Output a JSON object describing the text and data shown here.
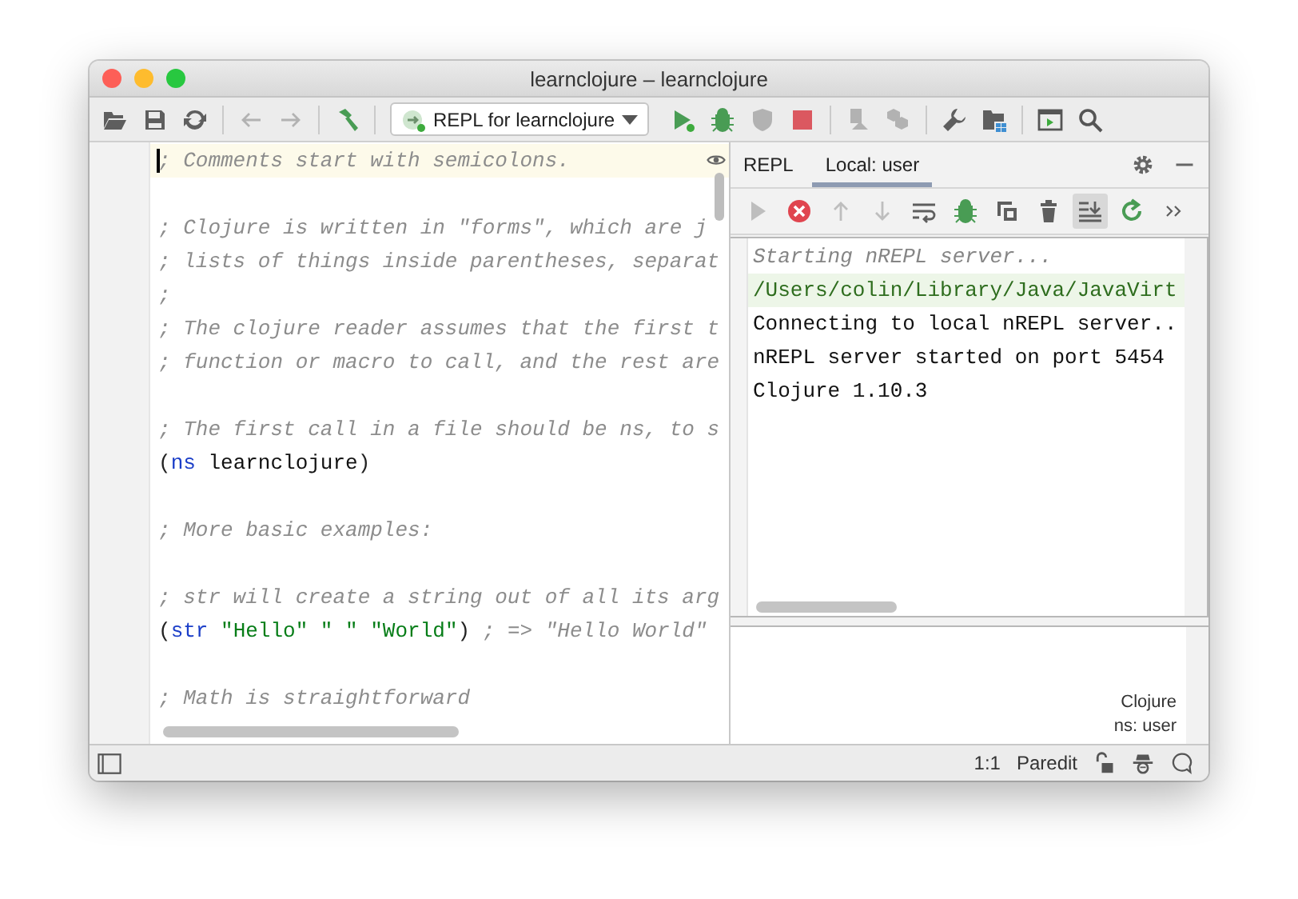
{
  "window": {
    "title": "learnclojure – learnclojure"
  },
  "toolbar": {
    "groups": [
      [
        {
          "kind": "open",
          "disabled": false
        },
        {
          "kind": "save",
          "disabled": false
        },
        {
          "kind": "sync",
          "disabled": false
        }
      ],
      [
        {
          "kind": "back",
          "disabled": true
        },
        {
          "kind": "forward",
          "disabled": true
        }
      ],
      [
        {
          "kind": "build",
          "disabled": false
        }
      ],
      [
        {
          "kind": "config",
          "disabled": false
        },
        {
          "kind": "run",
          "disabled": false
        },
        {
          "kind": "debug",
          "disabled": false
        },
        {
          "kind": "coverage",
          "disabled": true
        },
        {
          "kind": "stop",
          "disabled": false
        }
      ],
      [
        {
          "kind": "attach",
          "disabled": true
        },
        {
          "kind": "deploy",
          "disabled": true
        }
      ],
      [
        {
          "kind": "wrench",
          "disabled": false
        },
        {
          "kind": "structure",
          "disabled": false
        }
      ],
      [
        {
          "kind": "terminal",
          "disabled": false
        },
        {
          "kind": "search",
          "disabled": false
        }
      ]
    ],
    "run_config": "REPL for learnclojure"
  },
  "editor": {
    "lines": [
      {
        "current": true,
        "tokens": [
          {
            "kind": "comment",
            "text": "; Comments start with semicolons."
          }
        ]
      },
      {
        "current": false
      },
      {
        "current": false,
        "tokens": [
          {
            "kind": "comment",
            "text": "; Clojure is written in \"forms\", which are j"
          }
        ]
      },
      {
        "current": false,
        "tokens": [
          {
            "kind": "comment",
            "text": "; lists of things inside parentheses, separat"
          }
        ]
      },
      {
        "current": false,
        "tokens": [
          {
            "kind": "comment",
            "text": ";"
          }
        ]
      },
      {
        "current": false,
        "tokens": [
          {
            "kind": "comment",
            "text": "; The clojure reader assumes that the first t"
          }
        ]
      },
      {
        "current": false,
        "tokens": [
          {
            "kind": "comment",
            "text": "; function or macro to call, and the rest are"
          }
        ]
      },
      {
        "current": false
      },
      {
        "current": false,
        "tokens": [
          {
            "kind": "comment",
            "text": "; The first call in a file should be ns, to s"
          }
        ]
      },
      {
        "current": false,
        "tokens": [
          {
            "kind": "paren",
            "text": "("
          },
          {
            "kind": "keyword",
            "text": "ns"
          },
          {
            "kind": "plain",
            "text": " learnclojure"
          },
          {
            "kind": "paren",
            "text": ")"
          }
        ]
      },
      {
        "current": false
      },
      {
        "current": false,
        "tokens": [
          {
            "kind": "comment",
            "text": "; More basic examples:"
          }
        ]
      },
      {
        "current": false
      },
      {
        "current": false,
        "tokens": [
          {
            "kind": "comment",
            "text": "; str will create a string out of all its arg"
          }
        ]
      },
      {
        "current": false,
        "tokens": [
          {
            "kind": "paren",
            "text": "("
          },
          {
            "kind": "keyword",
            "text": "str"
          },
          {
            "kind": "string",
            "text": " \"Hello\" \" \" \"World\""
          },
          {
            "kind": "paren",
            "text": ")"
          },
          {
            "kind": "comment",
            "text": " ; => \"Hello World\""
          }
        ]
      },
      {
        "current": false
      },
      {
        "current": false,
        "tokens": [
          {
            "kind": "comment",
            "text": "; Math is straightforward"
          }
        ]
      }
    ]
  },
  "repl": {
    "tabs": [
      {
        "label": "REPL",
        "selected": false
      },
      {
        "label": "Local: user",
        "selected": true
      }
    ],
    "tools": [
      {
        "kind": "play",
        "disabled": true,
        "on": false
      },
      {
        "kind": "stop",
        "disabled": false,
        "on": false
      },
      {
        "kind": "up",
        "disabled": true,
        "on": false
      },
      {
        "kind": "down",
        "disabled": true,
        "on": false
      },
      {
        "kind": "wrap",
        "disabled": false,
        "on": false
      },
      {
        "kind": "debug",
        "disabled": false,
        "on": false
      },
      {
        "kind": "copy",
        "disabled": false,
        "on": false
      },
      {
        "kind": "trash",
        "disabled": false,
        "on": false
      },
      {
        "kind": "scroll",
        "disabled": false,
        "on": true
      },
      {
        "kind": "rerun",
        "disabled": false,
        "on": false
      },
      {
        "kind": "more",
        "disabled": false,
        "on": false
      }
    ],
    "output": [
      {
        "kind": "system",
        "text": "Starting nREPL server..."
      },
      {
        "kind": "path",
        "text": "/Users/colin/Library/Java/JavaVirt"
      },
      {
        "kind": "plain",
        "text": "Connecting to local nREPL server.."
      },
      {
        "kind": "plain",
        "text": "nREPL server started on port 5454"
      },
      {
        "kind": "plain",
        "text": "Clojure 1.10.3"
      }
    ],
    "language": "Clojure",
    "namespace": "ns: user"
  },
  "status_bar": {
    "position": "1:1",
    "mode": "Paredit"
  }
}
